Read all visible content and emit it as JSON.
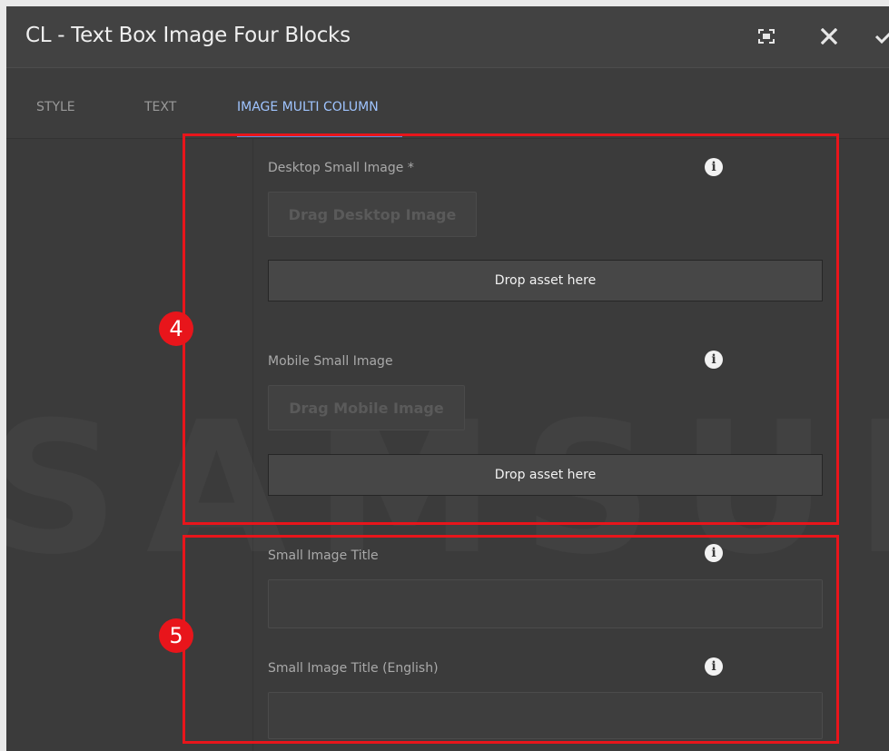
{
  "dialog": {
    "title": "CL - Text Box Image Four Blocks",
    "toolbar": {
      "fullscreen_icon": "fullscreen-icon",
      "close_icon": "close-icon",
      "confirm_icon": "check-icon"
    }
  },
  "tabs": [
    {
      "label": "STYLE",
      "active": false
    },
    {
      "label": "TEXT",
      "active": false
    },
    {
      "label": "IMAGE MULTI COLUMN",
      "active": true
    }
  ],
  "watermark": "SAMSUNG",
  "fields": {
    "desktop_image": {
      "label": "Desktop Small Image *",
      "drag_label": "Drag Desktop Image",
      "drop_label": "Drop asset here"
    },
    "mobile_image": {
      "label": "Mobile Small Image",
      "drag_label": "Drag Mobile Image",
      "drop_label": "Drop asset here"
    },
    "small_image_title": {
      "label": "Small Image Title",
      "value": ""
    },
    "small_image_title_english": {
      "label": "Small Image Title (English)",
      "value": ""
    }
  },
  "callouts": [
    {
      "number": "4"
    },
    {
      "number": "5"
    }
  ],
  "colors": {
    "callout": "#e8151b",
    "active_tab": "#9fc4ff",
    "tab_underline": "#5b8fe0"
  }
}
